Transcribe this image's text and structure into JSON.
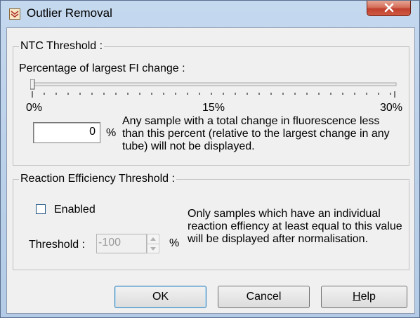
{
  "window": {
    "title": "Outlier Removal",
    "close_label": "X"
  },
  "ntc": {
    "group_title": "NTC Threshold :",
    "slider_label": "Percentage of largest FI change :",
    "slider_value": 0,
    "ticks": {
      "min": "0%",
      "mid": "15%",
      "max": "30%"
    },
    "value": "0",
    "unit": "%",
    "description": "Any sample with a total change in fluorescence less than this percent (relative to the largest change in any tube) will not be displayed."
  },
  "reaction": {
    "group_title": "Reaction Efficiency Threshold :",
    "enabled_label": "Enabled",
    "enabled_checked": false,
    "threshold_label": "Threshold :",
    "threshold_value": "-100",
    "unit": "%",
    "description": "Only samples which have an individual reaction effiency at least equal to this value will be displayed after normalisation."
  },
  "buttons": {
    "ok": "OK",
    "cancel": "Cancel",
    "help_prefix": "H",
    "help_rest": "elp"
  }
}
